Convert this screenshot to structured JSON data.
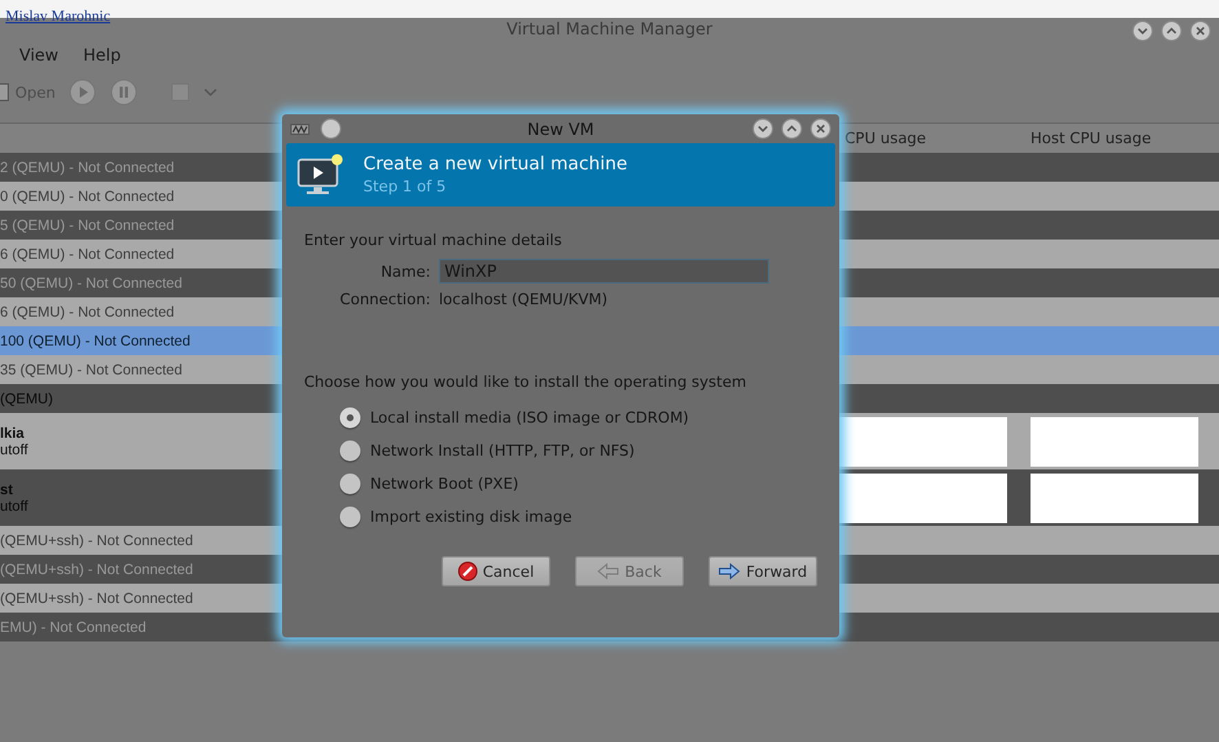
{
  "top_link": "Mislav Marohnic",
  "window": {
    "title": "Virtual Machine Manager"
  },
  "menu": [
    "View",
    "Help"
  ],
  "toolbar": {
    "open_label": "Open"
  },
  "table": {
    "columns": [
      "CPU usage",
      "Host CPU usage"
    ],
    "rows": [
      {
        "kind": "connection",
        "text": "2 (QEMU) - Not Connected",
        "connected": false,
        "selected": false
      },
      {
        "kind": "connection",
        "text": "0 (QEMU) - Not Connected",
        "connected": false,
        "selected": false
      },
      {
        "kind": "connection",
        "text": "5 (QEMU) - Not Connected",
        "connected": false,
        "selected": false
      },
      {
        "kind": "connection",
        "text": "6 (QEMU) - Not Connected",
        "connected": false,
        "selected": false
      },
      {
        "kind": "connection",
        "text": "50 (QEMU) - Not Connected",
        "connected": false,
        "selected": false
      },
      {
        "kind": "connection",
        "text": "6 (QEMU) - Not Connected",
        "connected": false,
        "selected": false
      },
      {
        "kind": "connection",
        "text": "100 (QEMU) - Not Connected",
        "connected": false,
        "selected": true
      },
      {
        "kind": "connection",
        "text": "35 (QEMU) - Not Connected",
        "connected": false,
        "selected": false
      },
      {
        "kind": "connection",
        "text": "(QEMU)",
        "connected": true,
        "selected": false
      },
      {
        "kind": "vm",
        "text": "lkia",
        "status": "utoff",
        "connected": true,
        "selected": false
      },
      {
        "kind": "vm",
        "text": "st",
        "status": "utoff",
        "connected": true,
        "selected": false
      },
      {
        "kind": "connection",
        "text": "(QEMU+ssh) - Not Connected",
        "connected": false,
        "selected": false
      },
      {
        "kind": "connection",
        "text": "(QEMU+ssh) - Not Connected",
        "connected": false,
        "selected": false
      },
      {
        "kind": "connection",
        "text": "(QEMU+ssh) - Not Connected",
        "connected": false,
        "selected": false
      },
      {
        "kind": "connection",
        "text": "EMU) - Not Connected",
        "connected": false,
        "selected": false
      }
    ]
  },
  "dialog": {
    "title": "New VM",
    "header": {
      "title": "Create a new virtual machine",
      "subtitle": "Step 1 of 5"
    },
    "details_heading": "Enter your virtual machine details",
    "name_label": "Name:",
    "name_value": "WinXP",
    "connection_label": "Connection:",
    "connection_value": "localhost (QEMU/KVM)",
    "install_heading": "Choose how you would like to install the operating system",
    "options": [
      {
        "label": "Local install media (ISO image or CDROM)",
        "selected": true
      },
      {
        "label": "Network Install (HTTP, FTP, or NFS)",
        "selected": false
      },
      {
        "label": "Network Boot (PXE)",
        "selected": false
      },
      {
        "label": "Import existing disk image",
        "selected": false
      }
    ],
    "buttons": [
      {
        "kind": "cancel",
        "label": "Cancel",
        "disabled": false
      },
      {
        "kind": "back",
        "label": "Back",
        "disabled": true
      },
      {
        "kind": "forward",
        "label": "Forward",
        "disabled": false
      }
    ]
  }
}
